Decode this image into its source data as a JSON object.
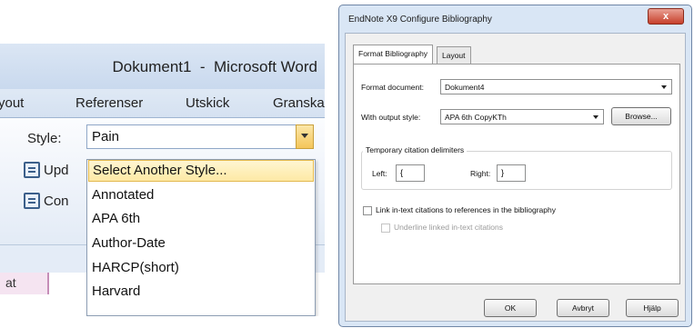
{
  "word": {
    "title": "Dokument1  -  Microsoft Word",
    "tabs": [
      "yout",
      "Referenser",
      "Utskick",
      "Granska"
    ],
    "style_label": "Style:",
    "style_value": "Pain",
    "ribbon_buttons": [
      "Upd",
      "Con"
    ],
    "doc_tab_label": "at",
    "dropdown_items": [
      "Select Another Style...",
      "Annotated",
      "APA 6th",
      "Author-Date",
      "HARCP(short)",
      "Harvard"
    ]
  },
  "dialog": {
    "title": "EndNote X9 Configure Bibliography",
    "close_label": "x",
    "tabs": [
      "Format Bibliography",
      "Layout"
    ],
    "format_document_label": "Format document:",
    "format_document_value": "Dokument4",
    "output_style_label": "With output style:",
    "output_style_value": "APA 6th CopyKTh",
    "browse_label": "Browse...",
    "delimiters_title": "Temporary citation delimiters",
    "left_label": "Left:",
    "left_value": "{",
    "right_label": "Right:",
    "right_value": "}",
    "link_label": "Link in-text citations to references in the bibliography",
    "underline_label": "Underline linked in-text citations",
    "buttons": {
      "ok": "OK",
      "cancel": "Avbryt",
      "help": "Hjälp"
    }
  }
}
